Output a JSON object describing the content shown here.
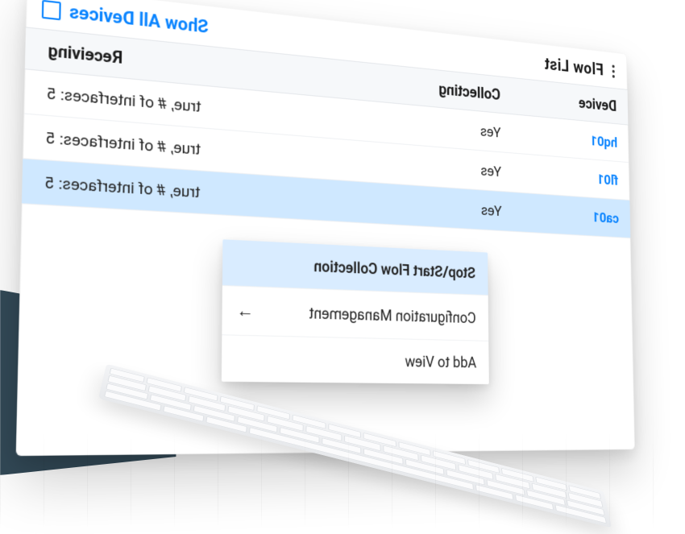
{
  "header": {
    "title": "Flow List",
    "show_all_label": "Show All Devices",
    "show_all_checked": false
  },
  "columns": {
    "device": "Device",
    "collecting": "Collecting",
    "receiving": "Receiving"
  },
  "rows": [
    {
      "device": "hq01",
      "collecting": "Yes",
      "receiving": "true, # of interfaces: 5",
      "selected": false
    },
    {
      "device": "fl01",
      "collecting": "Yes",
      "receiving": "true, # of interfaces: 5",
      "selected": false
    },
    {
      "device": "ca01",
      "collecting": "Yes",
      "receiving": "true, # of interfaces: 5",
      "selected": true
    }
  ],
  "context_menu": {
    "items": [
      {
        "label": "Stop\\Start Flow Collection",
        "highlight": true,
        "submenu": false
      },
      {
        "label": "Configuration Management",
        "highlight": false,
        "submenu": true
      },
      {
        "label": "Add to View",
        "highlight": false,
        "submenu": false
      }
    ]
  },
  "colors": {
    "accent": "#0a84ff",
    "row_selected": "#cfe8ff",
    "menu_highlight": "#d9ecff"
  }
}
